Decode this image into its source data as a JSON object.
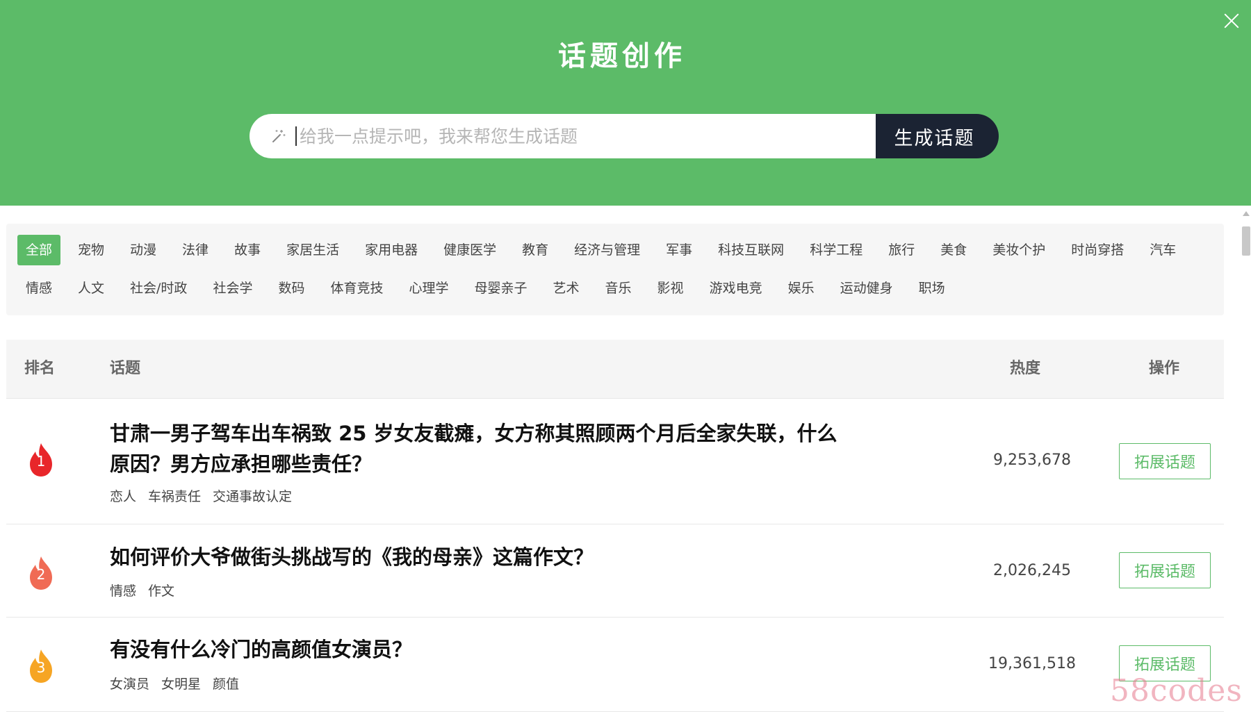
{
  "header": {
    "title": "话题创作",
    "search": {
      "placeholder": "给我一点提示吧，我来帮您生成话题",
      "value": ""
    },
    "generate_label": "生成话题",
    "close_icon": "close-icon",
    "wand_icon": "magic-wand-icon"
  },
  "categories": {
    "row1": [
      "全部",
      "宠物",
      "动漫",
      "法律",
      "故事",
      "家居生活",
      "家用电器",
      "健康医学",
      "教育",
      "经济与管理",
      "军事",
      "科技互联网",
      "科学工程",
      "旅行",
      "美食",
      "美妆个护",
      "时尚穿搭",
      "汽车"
    ],
    "row2": [
      "情感",
      "人文",
      "社会/时政",
      "社会学",
      "数码",
      "体育竞技",
      "心理学",
      "母婴亲子",
      "艺术",
      "音乐",
      "影视",
      "游戏电竞",
      "娱乐",
      "运动健身",
      "职场"
    ],
    "active": "全部"
  },
  "table": {
    "headers": {
      "rank": "排名",
      "topic": "话题",
      "heat": "热度",
      "action": "操作"
    },
    "rows": [
      {
        "rank": "1",
        "title_line1": "甘肃一男子驾车出车祸致 25 岁女友截瘫，女方称其照顾两个月后全家失联，什么",
        "title_line2": "原因？男方应承担哪些责任？",
        "tags": [
          "恋人",
          "车祸责任",
          "交通事故认定"
        ],
        "heat": "9,253,678",
        "action": "拓展话题",
        "icon_color": "#e8262a"
      },
      {
        "rank": "2",
        "title_line1": "如何评价大爷做街头挑战写的《我的母亲》这篇作文？",
        "tags": [
          "情感",
          "作文"
        ],
        "heat": "2,026,245",
        "action": "拓展话题",
        "icon_color": "#f06b55"
      },
      {
        "rank": "3",
        "title_line1": "有没有什么冷门的高颜值女演员？",
        "tags": [
          "女演员",
          "女明星",
          "颜值"
        ],
        "heat": "19,361,518",
        "action": "拓展话题",
        "icon_color": "#f6a524"
      }
    ]
  },
  "watermark": "58codes",
  "colors": {
    "header_bg": "#5cbb68",
    "accent": "#5cbb68",
    "button_dark": "#1b2333"
  }
}
